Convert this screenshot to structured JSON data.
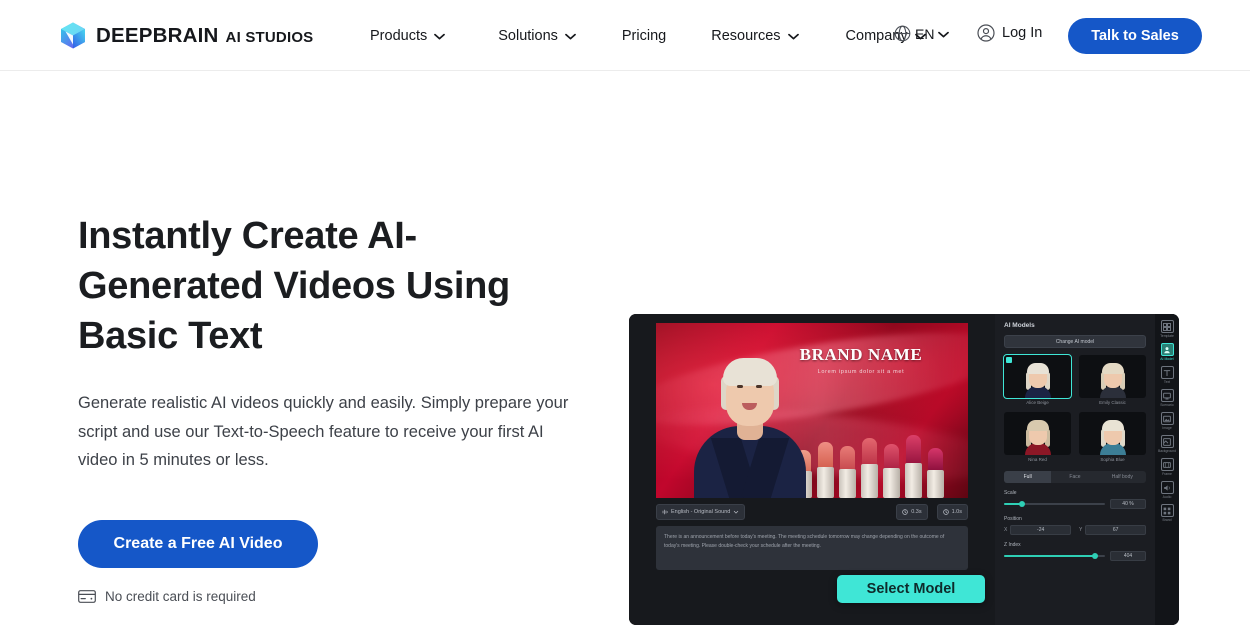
{
  "header": {
    "logo": {
      "icon": "cube-logo-icon",
      "name": "DEEPBRAIN",
      "sub": "AI STUDIOS"
    },
    "nav": [
      {
        "label": "Products",
        "has_caret": true,
        "name": "nav-products"
      },
      {
        "label": "Solutions",
        "has_caret": true,
        "name": "nav-solutions"
      },
      {
        "label": "Pricing",
        "has_caret": false,
        "name": "nav-pricing"
      },
      {
        "label": "Resources",
        "has_caret": true,
        "name": "nav-resources"
      },
      {
        "label": "Company",
        "has_caret": true,
        "name": "nav-company"
      }
    ],
    "language": {
      "icon": "globe-icon",
      "label": "EN"
    },
    "login": {
      "icon": "user-circle-icon",
      "label": "Log In"
    },
    "cta": {
      "label": "Talk to Sales",
      "color": "#1557c8"
    }
  },
  "hero": {
    "title": "Instantly Create AI-Generated Videos Using Basic Text",
    "subtitle": "Generate realistic AI videos quickly and easily. Simply prepare your script and use our Text-to-Speech feature to receive your first AI video in 5 minutes or less.",
    "cta": {
      "label": "Create a Free AI Video",
      "color": "#1557c8"
    },
    "note": {
      "icon": "credit-card-icon",
      "label": "No credit card is required"
    }
  },
  "mockup": {
    "stage": {
      "brand_title": "BRAND NAME",
      "brand_tagline": "Lorem ipsum dolor sit a met"
    },
    "toolbar": {
      "voice_chip": "English - Original Sound",
      "badge_1": "0.3s",
      "badge_2": "1.0s"
    },
    "script": "There is an announcement before today's meeting. The meeting schedule tomorrow may change depending on the outcome of today's meeting. Please double-check your schedule after the meeting.",
    "select_model_button": {
      "label": "Select Model",
      "color": "#3fe6d6"
    },
    "panel": {
      "title": "AI Models",
      "change_button": "Change AI model",
      "models": [
        {
          "label": "Alice Beige",
          "selected": true,
          "hair": "#e8e2d6",
          "body": "#1b2344"
        },
        {
          "label": "Emily Classic",
          "selected": false,
          "hair": "#e4d9c4",
          "body": "#2b2f3a"
        },
        {
          "label": "Nina Red",
          "selected": false,
          "hair": "#d8c9ae",
          "body": "#8c1726"
        },
        {
          "label": "Sophia Blue",
          "selected": false,
          "hair": "#e9e3d4",
          "body": "#3c7e96"
        }
      ],
      "tabs": [
        {
          "label": "Full",
          "active": true
        },
        {
          "label": "Face",
          "active": false
        },
        {
          "label": "Half body",
          "active": false
        }
      ],
      "controls": {
        "scale": {
          "label": "Scale",
          "value": "40 %",
          "percent": 18
        },
        "position": {
          "label": "Position",
          "x_axis": "X",
          "x_value": "-24",
          "y_axis": "Y",
          "y_value": "67"
        },
        "zindex": {
          "label": "Z Index",
          "value": "404",
          "percent": 90
        }
      }
    },
    "rail": [
      {
        "icon": "templates-icon",
        "label": "Template",
        "active": false
      },
      {
        "icon": "avatar-icon",
        "label": "AI Model",
        "active": true
      },
      {
        "icon": "text-icon",
        "label": "Text",
        "active": false
      },
      {
        "icon": "screen-icon",
        "label": "Scenario",
        "active": false
      },
      {
        "icon": "image-icon",
        "label": "Image",
        "active": false
      },
      {
        "icon": "bg-icon",
        "label": "Background",
        "active": false
      },
      {
        "icon": "frame-icon",
        "label": "Frame",
        "active": false
      },
      {
        "icon": "audio-icon",
        "label": "Audio",
        "active": false
      },
      {
        "icon": "brand-icon",
        "label": "Brand",
        "active": false
      }
    ]
  }
}
